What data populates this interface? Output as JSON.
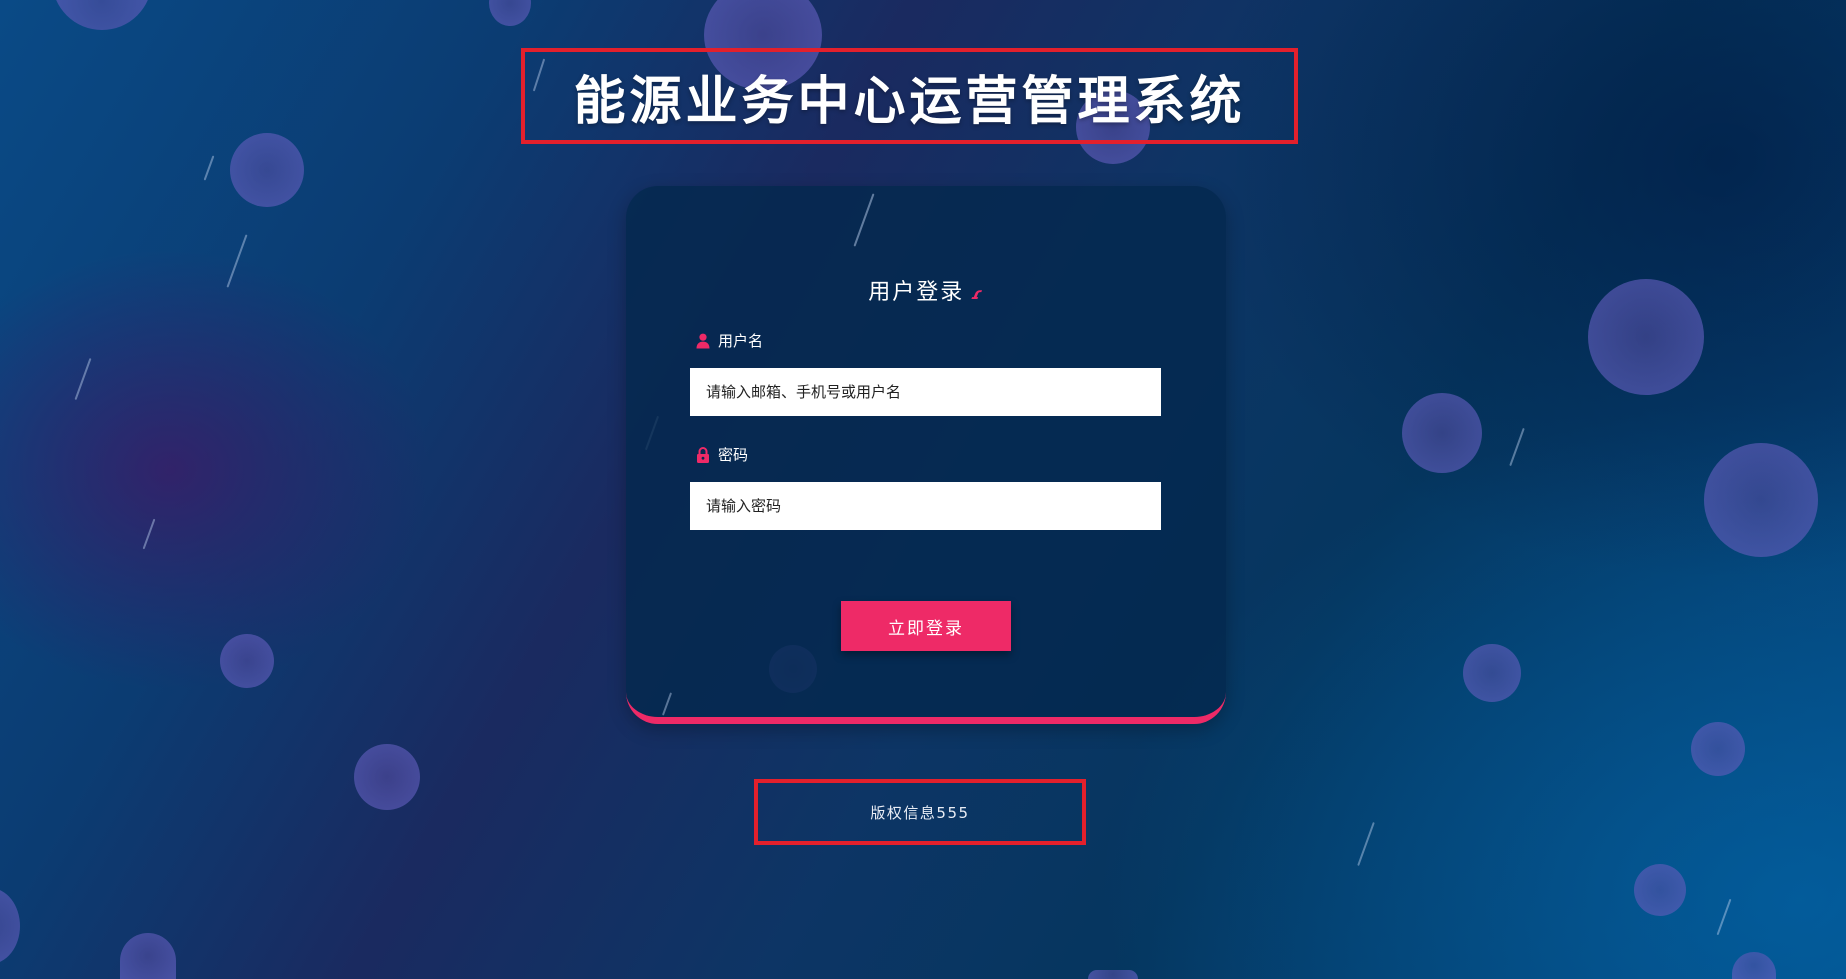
{
  "page": {
    "title": "能源业务中心运营管理系统"
  },
  "login": {
    "heading": "用户登录",
    "heading_icon": "signature-icon",
    "username": {
      "label": "用户名",
      "icon": "user-icon",
      "placeholder": "请输入邮箱、手机号或用户名",
      "value": ""
    },
    "password": {
      "label": "密码",
      "icon": "lock-icon",
      "placeholder": "请输入密码",
      "value": ""
    },
    "submit_label": "立即登录"
  },
  "footer": {
    "copyright": "版权信息555"
  },
  "colors": {
    "accent": "#ee2a67",
    "highlight_border": "#e3202c",
    "card_background": "#04284e",
    "background_primary": "#0a4a86"
  }
}
